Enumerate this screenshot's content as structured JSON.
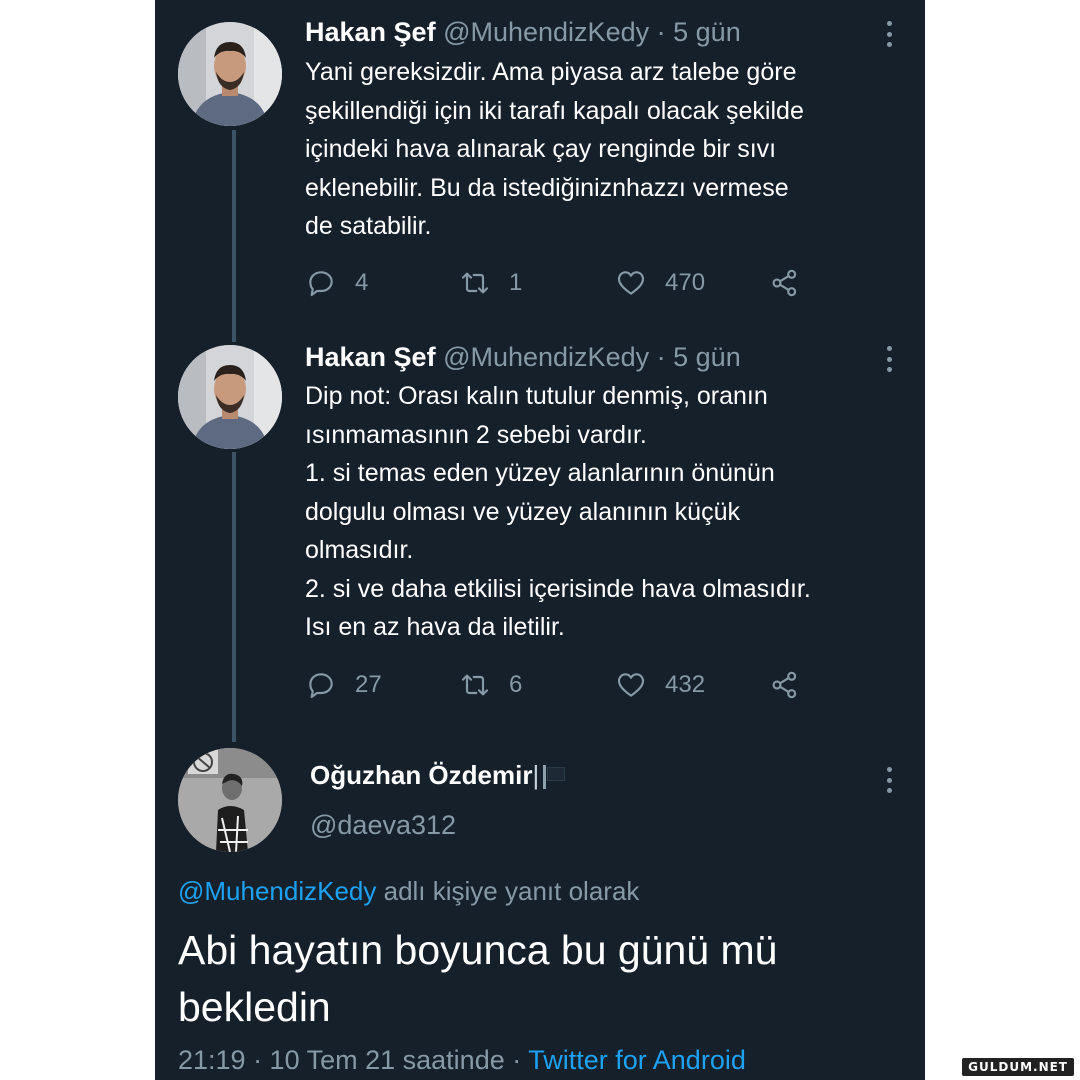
{
  "tweets": [
    {
      "author_name": "Hakan Şef",
      "handle": "@MuhendizKedy",
      "separator": "·",
      "time": "5 gün",
      "text": "Yani gereksizdir. Ama piyasa arz talebe göre\nşekillendiği için iki tarafı kapalı olacak şekilde\niçindeki hava alınarak çay renginde bir sıvı\neklenebilir. Bu da istediğiniznhazzı vermese\nde satabilir.",
      "replies": "4",
      "retweets": "1",
      "likes": "470"
    },
    {
      "author_name": "Hakan Şef",
      "handle": "@MuhendizKedy",
      "separator": "·",
      "time": "5 gün",
      "text": "Dip not: Orası kalın tutulur denmiş, oranın\nısınmamasının 2 sebebi vardır.\n1. si  temas eden yüzey alanlarının önünün\ndolgulu olması ve yüzey alanının küçük\nolmasıdır.\n2. si ve daha etkilisi içerisinde hava olmasıdır.\nIsı en az hava da iletilir.",
      "replies": "27",
      "retweets": "6",
      "likes": "432"
    }
  ],
  "reply": {
    "author_name": "Oğuzhan Özdemir",
    "name_suffix": "|",
    "handle": "@daeva312",
    "context_mention": "@MuhendizKedy",
    "context_text": " adlı kişiye yanıt olarak",
    "text": "Abi hayatın boyunca bu günü mü bekledin",
    "timestamp": "21:19 · 10 Tem 21 saatinde · ",
    "source": "Twitter for Android"
  },
  "watermark": "GULDUM.NET",
  "colors": {
    "background": "#15202b",
    "text": "#ffffff",
    "secondary": "#8899a6",
    "link": "#1da1f2",
    "thread_line": "#3d5466"
  }
}
